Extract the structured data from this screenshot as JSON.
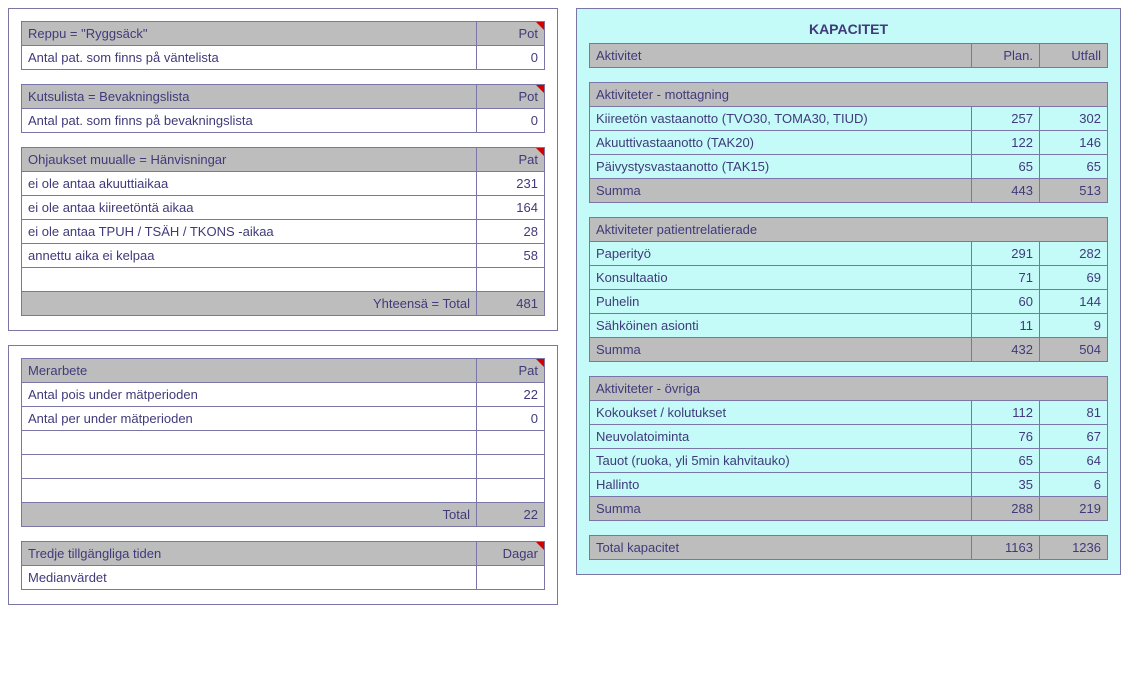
{
  "left": {
    "reppu": {
      "title": "Reppu = \"Ryggsäck\"",
      "col": "Pot",
      "rows": [
        {
          "label": "Antal pat. som finns på väntelista",
          "val": "0"
        }
      ]
    },
    "kutsu": {
      "title": "Kutsulista = Bevakningslista",
      "col": "Pot",
      "rows": [
        {
          "label": "Antal pat. som finns på bevakningslista",
          "val": "0"
        }
      ]
    },
    "ohj": {
      "title": "Ohjaukset muualle = Hänvisningar",
      "col": "Pat",
      "rows": [
        {
          "label": "ei ole antaa akuuttiaikaa",
          "val": "231"
        },
        {
          "label": "ei ole antaa kiireetöntä aikaa",
          "val": "164"
        },
        {
          "label": "ei ole antaa TPUH / TSÄH / TKONS -aikaa",
          "val": "28"
        },
        {
          "label": "annettu aika ei kelpaa",
          "val": "58"
        }
      ],
      "blank": "",
      "total_label": "Yhteensä = Total",
      "total_val": "481"
    },
    "mer": {
      "title": "Merarbete",
      "col": "Pat",
      "rows": [
        {
          "label": "Antal pois under mätperioden",
          "val": "22"
        },
        {
          "label": "Antal per under mätperioden",
          "val": "0"
        }
      ],
      "total_label": "Total",
      "total_val": "22"
    },
    "tredje": {
      "title": "Tredje tillgängliga tiden",
      "col": "Dagar",
      "rows": [
        {
          "label": "Medianvärdet",
          "val": ""
        }
      ]
    }
  },
  "right": {
    "title": "KAPACITET",
    "headers": {
      "c1": "Aktivitet",
      "c2": "Plan.",
      "c3": "Utfall"
    },
    "sections": [
      {
        "name": "Aktiviteter - mottagning",
        "rows": [
          {
            "label": "Kiireetön vastaanotto (TVO30, TOMA30, TIUD)",
            "plan": "257",
            "ut": "302"
          },
          {
            "label": "Akuuttivastaanotto (TAK20)",
            "plan": "122",
            "ut": "146"
          },
          {
            "label": "Päivystysvastaanotto (TAK15)",
            "plan": "65",
            "ut": "65"
          }
        ],
        "sum": {
          "label": "Summa",
          "plan": "443",
          "ut": "513"
        }
      },
      {
        "name": "Aktiviteter patientrelatierade",
        "rows": [
          {
            "label": "Paperityö",
            "plan": "291",
            "ut": "282"
          },
          {
            "label": "Konsultaatio",
            "plan": "71",
            "ut": "69"
          },
          {
            "label": "Puhelin",
            "plan": "60",
            "ut": "144"
          },
          {
            "label": "Sähköinen asionti",
            "plan": "11",
            "ut": "9"
          }
        ],
        "sum": {
          "label": "Summa",
          "plan": "432",
          "ut": "504"
        }
      },
      {
        "name": "Aktiviteter - övriga",
        "rows": [
          {
            "label": "Kokoukset / kolutukset",
            "plan": "112",
            "ut": "81"
          },
          {
            "label": "Neuvolatoiminta",
            "plan": "76",
            "ut": "67"
          },
          {
            "label": "Tauot (ruoka, yli 5min kahvitauko)",
            "plan": "65",
            "ut": "64"
          },
          {
            "label": "Hallinto",
            "plan": "35",
            "ut": "6"
          }
        ],
        "sum": {
          "label": "Summa",
          "plan": "288",
          "ut": "219"
        }
      }
    ],
    "total": {
      "label": "Total kapacitet",
      "plan": "1163",
      "ut": "1236"
    }
  }
}
